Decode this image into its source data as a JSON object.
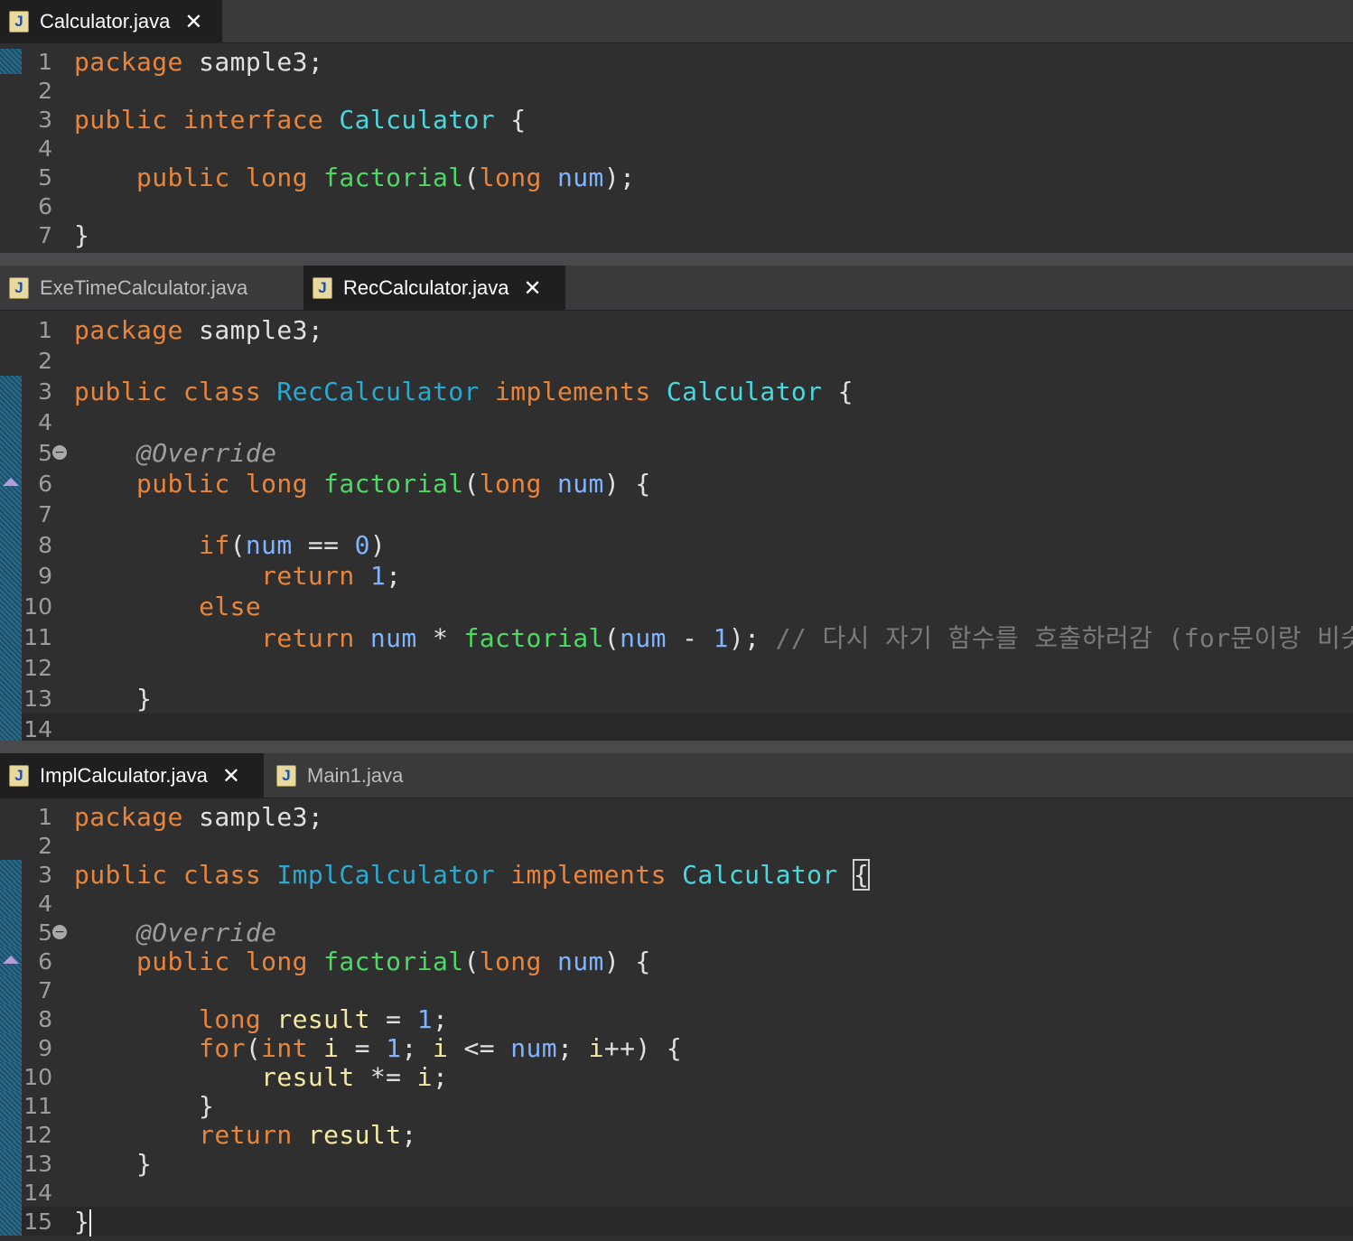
{
  "panes": [
    {
      "tabs": [
        {
          "label": "Calculator.java",
          "active": true,
          "closable": true
        }
      ],
      "lines": [
        {
          "n": "1",
          "tokens": [
            [
              "kw",
              "package"
            ],
            [
              "t",
              " sample3;"
            ]
          ]
        },
        {
          "n": "2",
          "tokens": []
        },
        {
          "n": "3",
          "tokens": [
            [
              "kw",
              "public"
            ],
            [
              "t",
              " "
            ],
            [
              "kw",
              "interface"
            ],
            [
              "t",
              " "
            ],
            [
              "ty",
              "Calculator"
            ],
            [
              "t",
              " {"
            ]
          ]
        },
        {
          "n": "4",
          "tokens": []
        },
        {
          "n": "5",
          "tokens": [
            [
              "t",
              "    "
            ],
            [
              "kw",
              "public"
            ],
            [
              "t",
              " "
            ],
            [
              "kw",
              "long"
            ],
            [
              "t",
              " "
            ],
            [
              "mth",
              "factorial"
            ],
            [
              "t",
              "("
            ],
            [
              "kw",
              "long"
            ],
            [
              "t",
              " "
            ],
            [
              "par",
              "num"
            ],
            [
              "t",
              ");"
            ]
          ]
        },
        {
          "n": "6",
          "tokens": []
        },
        {
          "n": "7",
          "tokens": [
            [
              "t",
              "}"
            ]
          ]
        }
      ]
    },
    {
      "tabs": [
        {
          "label": "ExeTimeCalculator.java",
          "active": false,
          "closable": false
        },
        {
          "label": "RecCalculator.java",
          "active": true,
          "closable": true
        }
      ],
      "lines": [
        {
          "n": "1",
          "tokens": [
            [
              "kw",
              "package"
            ],
            [
              "t",
              " sample3;"
            ]
          ]
        },
        {
          "n": "2",
          "tokens": []
        },
        {
          "n": "3",
          "tokens": [
            [
              "kw",
              "public"
            ],
            [
              "t",
              " "
            ],
            [
              "kw",
              "class"
            ],
            [
              "t",
              " "
            ],
            [
              "cls",
              "RecCalculator"
            ],
            [
              "t",
              " "
            ],
            [
              "kw",
              "implements"
            ],
            [
              "t",
              " "
            ],
            [
              "ty",
              "Calculator"
            ],
            [
              "t",
              " {"
            ]
          ]
        },
        {
          "n": "4",
          "tokens": []
        },
        {
          "n": "5",
          "fold": true,
          "tokens": [
            [
              "t",
              "    "
            ],
            [
              "ann",
              "@Override"
            ]
          ]
        },
        {
          "n": "6",
          "override": true,
          "tokens": [
            [
              "t",
              "    "
            ],
            [
              "kw",
              "public"
            ],
            [
              "t",
              " "
            ],
            [
              "kw",
              "long"
            ],
            [
              "t",
              " "
            ],
            [
              "mth",
              "factorial"
            ],
            [
              "t",
              "("
            ],
            [
              "kw",
              "long"
            ],
            [
              "t",
              " "
            ],
            [
              "par",
              "num"
            ],
            [
              "t",
              ") {"
            ]
          ]
        },
        {
          "n": "7",
          "tokens": []
        },
        {
          "n": "8",
          "tokens": [
            [
              "t",
              "        "
            ],
            [
              "kw",
              "if"
            ],
            [
              "t",
              "("
            ],
            [
              "par",
              "num"
            ],
            [
              "t",
              " == "
            ],
            [
              "num",
              "0"
            ],
            [
              "t",
              ")"
            ]
          ]
        },
        {
          "n": "9",
          "tokens": [
            [
              "t",
              "            "
            ],
            [
              "kw",
              "return"
            ],
            [
              "t",
              " "
            ],
            [
              "num",
              "1"
            ],
            [
              "t",
              ";"
            ]
          ]
        },
        {
          "n": "10",
          "tokens": [
            [
              "t",
              "        "
            ],
            [
              "kw",
              "else"
            ]
          ]
        },
        {
          "n": "11",
          "tokens": [
            [
              "t",
              "            "
            ],
            [
              "kw",
              "return"
            ],
            [
              "t",
              " "
            ],
            [
              "par",
              "num"
            ],
            [
              "t",
              " * "
            ],
            [
              "mth",
              "factorial"
            ],
            [
              "t",
              "("
            ],
            [
              "par",
              "num"
            ],
            [
              "t",
              " - "
            ],
            [
              "num",
              "1"
            ],
            [
              "t",
              "); "
            ],
            [
              "cmt",
              "// 다시 자기 함수를 호출하러감 (for문이랑 비슷)"
            ]
          ]
        },
        {
          "n": "12",
          "tokens": []
        },
        {
          "n": "13",
          "tokens": [
            [
              "t",
              "    }"
            ]
          ]
        },
        {
          "n": "14",
          "current": true,
          "tokens": []
        }
      ]
    },
    {
      "tabs": [
        {
          "label": "ImplCalculator.java",
          "active": true,
          "closable": true
        },
        {
          "label": "Main1.java",
          "active": false,
          "closable": false
        }
      ],
      "lines": [
        {
          "n": "1",
          "tokens": [
            [
              "kw",
              "package"
            ],
            [
              "t",
              " sample3;"
            ]
          ]
        },
        {
          "n": "2",
          "tokens": []
        },
        {
          "n": "3",
          "tokens": [
            [
              "kw",
              "public"
            ],
            [
              "t",
              " "
            ],
            [
              "kw",
              "class"
            ],
            [
              "t",
              " "
            ],
            [
              "cls",
              "ImplCalculator"
            ],
            [
              "t",
              " "
            ],
            [
              "kw",
              "implements"
            ],
            [
              "t",
              " "
            ],
            [
              "ty",
              "Calculator"
            ],
            [
              "t",
              " "
            ],
            [
              "box",
              "{"
            ]
          ]
        },
        {
          "n": "4",
          "tokens": []
        },
        {
          "n": "5",
          "fold": true,
          "tokens": [
            [
              "t",
              "    "
            ],
            [
              "ann",
              "@Override"
            ]
          ]
        },
        {
          "n": "6",
          "override": true,
          "tokens": [
            [
              "t",
              "    "
            ],
            [
              "kw",
              "public"
            ],
            [
              "t",
              " "
            ],
            [
              "kw",
              "long"
            ],
            [
              "t",
              " "
            ],
            [
              "mth",
              "factorial"
            ],
            [
              "t",
              "("
            ],
            [
              "kw",
              "long"
            ],
            [
              "t",
              " "
            ],
            [
              "par",
              "num"
            ],
            [
              "t",
              ") {"
            ]
          ]
        },
        {
          "n": "7",
          "tokens": []
        },
        {
          "n": "8",
          "tokens": [
            [
              "t",
              "        "
            ],
            [
              "kw",
              "long"
            ],
            [
              "t",
              " "
            ],
            [
              "var",
              "result"
            ],
            [
              "t",
              " = "
            ],
            [
              "num",
              "1"
            ],
            [
              "t",
              ";"
            ]
          ]
        },
        {
          "n": "9",
          "tokens": [
            [
              "t",
              "        "
            ],
            [
              "kw",
              "for"
            ],
            [
              "t",
              "("
            ],
            [
              "kw",
              "int"
            ],
            [
              "t",
              " "
            ],
            [
              "var",
              "i"
            ],
            [
              "t",
              " = "
            ],
            [
              "num",
              "1"
            ],
            [
              "t",
              "; "
            ],
            [
              "var",
              "i"
            ],
            [
              "t",
              " <= "
            ],
            [
              "par",
              "num"
            ],
            [
              "t",
              "; "
            ],
            [
              "var",
              "i"
            ],
            [
              "t",
              "++) {"
            ]
          ]
        },
        {
          "n": "10",
          "tokens": [
            [
              "t",
              "            "
            ],
            [
              "var",
              "result"
            ],
            [
              "t",
              " *= "
            ],
            [
              "var",
              "i"
            ],
            [
              "t",
              ";"
            ]
          ]
        },
        {
          "n": "11",
          "tokens": [
            [
              "t",
              "        }"
            ]
          ]
        },
        {
          "n": "12",
          "tokens": [
            [
              "t",
              "        "
            ],
            [
              "kw",
              "return"
            ],
            [
              "t",
              " "
            ],
            [
              "var",
              "result"
            ],
            [
              "t",
              ";"
            ]
          ]
        },
        {
          "n": "13",
          "tokens": [
            [
              "t",
              "    }"
            ]
          ]
        },
        {
          "n": "14",
          "tokens": []
        },
        {
          "n": "15",
          "current": true,
          "cursor": true,
          "tokens": [
            [
              "t",
              "}"
            ]
          ]
        }
      ]
    }
  ]
}
